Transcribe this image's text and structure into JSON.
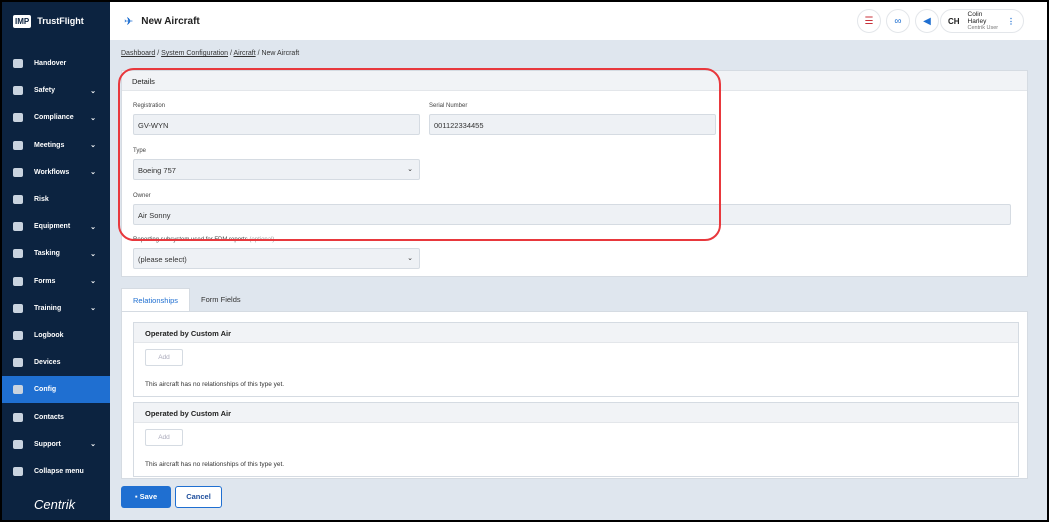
{
  "app": {
    "logo_badge": "IMP",
    "name": "TrustFlight",
    "brand": "Centrik"
  },
  "sidebar": {
    "items": [
      {
        "label": "Handover",
        "chevron": false
      },
      {
        "label": "Safety",
        "chevron": true
      },
      {
        "label": "Compliance",
        "chevron": true
      },
      {
        "label": "Meetings",
        "chevron": true
      },
      {
        "label": "Workflows",
        "chevron": true
      },
      {
        "label": "Risk",
        "chevron": false
      },
      {
        "label": "Equipment",
        "chevron": true
      },
      {
        "label": "Tasking",
        "chevron": true
      },
      {
        "label": "Forms",
        "chevron": true
      },
      {
        "label": "Training",
        "chevron": true
      },
      {
        "label": "Logbook",
        "chevron": false
      },
      {
        "label": "Devices",
        "chevron": false
      },
      {
        "label": "Config",
        "chevron": false,
        "active": true
      },
      {
        "label": "Contacts",
        "chevron": false
      },
      {
        "label": "Support",
        "chevron": true
      },
      {
        "label": "Collapse menu",
        "chevron": false
      }
    ]
  },
  "header": {
    "title": "New Aircraft",
    "user_initials": "CH",
    "user_name": "Colin Harley",
    "user_role": "Centrik User"
  },
  "breadcrumb": [
    "Dashboard",
    "System Configuration",
    "Aircraft",
    "New Aircraft"
  ],
  "details": {
    "heading": "Details",
    "registration_label": "Registration",
    "registration": "GV-WYN",
    "serial_label": "Serial Number",
    "serial": "001122334455",
    "type_label": "Type",
    "type": "Boeing 757",
    "owner_label": "Owner",
    "owner": "Air Sonny",
    "reporting_label": "Reporting subsystem used for FDM reports",
    "reporting_optional": "(optional)",
    "reporting": "(please select)"
  },
  "tabs": [
    "Relationships",
    "Form Fields"
  ],
  "relationships": [
    {
      "title": "Operated by Custom Air",
      "add": "Add",
      "empty": "This aircraft has no relationships of this type yet."
    },
    {
      "title": "Operated by Custom Air",
      "add": "Add",
      "empty": "This aircraft has no relationships of this type yet."
    }
  ],
  "actions": {
    "save": "Save",
    "cancel": "Cancel"
  },
  "colors": {
    "sidebar": "#0c2340",
    "accent": "#1f6fd1",
    "highlight": "#e8383d"
  }
}
